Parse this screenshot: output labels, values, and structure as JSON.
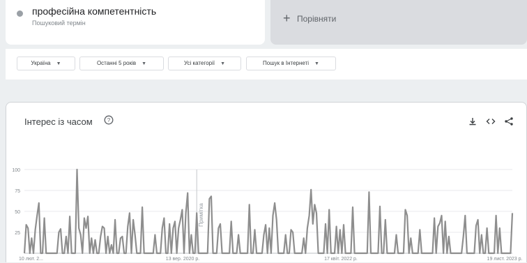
{
  "search_term": {
    "title": "професійна компетентність",
    "subtitle": "Пошуковий термін"
  },
  "compare": {
    "label": "Порівняти"
  },
  "filters": {
    "region": "Україна",
    "period": "Останні 5 років",
    "category": "Усі категорії",
    "search_type": "Пошук в Інтернеті"
  },
  "chart_header": {
    "title": "Інтерес із часом",
    "help_icon": "help-circle-icon",
    "actions": [
      "download-icon",
      "embed-code-icon",
      "share-icon"
    ]
  },
  "chart_data": {
    "type": "line",
    "title": "Інтерес із часом",
    "xlabel": "",
    "ylabel": "",
    "ylim": [
      0,
      100
    ],
    "y_ticks": [
      25,
      50,
      75,
      100
    ],
    "x_tick_labels": [
      "10 лют. 2...",
      "13 вер. 2020 р.",
      "17 квіт. 2022 р.",
      "19 лист. 2023 р."
    ],
    "annotation": "Примітка",
    "annotation_index": 95,
    "line_color": "#8e8e8e",
    "grid": true,
    "series": [
      {
        "values": [
          0,
          34,
          30,
          0,
          18,
          0,
          28,
          45,
          60,
          0,
          0,
          42,
          0,
          0,
          0,
          0,
          0,
          0,
          0,
          25,
          29,
          0,
          0,
          20,
          0,
          44,
          0,
          0,
          0,
          100,
          30,
          22,
          0,
          42,
          30,
          44,
          0,
          18,
          0,
          16,
          0,
          0,
          20,
          32,
          30,
          0,
          20,
          0,
          10,
          0,
          40,
          0,
          0,
          18,
          20,
          0,
          0,
          32,
          48,
          0,
          40,
          22,
          0,
          0,
          0,
          55,
          0,
          0,
          0,
          0,
          0,
          0,
          22,
          0,
          0,
          0,
          30,
          42,
          0,
          0,
          35,
          0,
          30,
          38,
          0,
          30,
          40,
          52,
          0,
          48,
          72,
          0,
          22,
          0,
          0,
          48,
          0,
          0,
          0,
          0,
          0,
          0,
          65,
          68,
          0,
          0,
          0,
          30,
          35,
          0,
          0,
          0,
          0,
          0,
          38,
          0,
          0,
          0,
          22,
          0,
          0,
          0,
          0,
          0,
          58,
          0,
          0,
          28,
          0,
          0,
          0,
          0,
          22,
          34,
          0,
          30,
          0,
          45,
          60,
          40,
          0,
          0,
          0,
          0,
          22,
          0,
          0,
          28,
          25,
          0,
          0,
          0,
          0,
          0,
          18,
          0,
          30,
          45,
          76,
          35,
          58,
          48,
          0,
          0,
          0,
          0,
          35,
          0,
          52,
          0,
          0,
          0,
          32,
          0,
          28,
          0,
          34,
          0,
          0,
          0,
          0,
          55,
          0,
          0,
          0,
          0,
          0,
          0,
          0,
          0,
          73,
          0,
          0,
          0,
          0,
          0,
          56,
          0,
          0,
          40,
          0,
          0,
          0,
          0,
          0,
          22,
          0,
          0,
          0,
          0,
          52,
          45,
          0,
          18,
          0,
          0,
          0,
          0,
          28,
          0,
          0,
          0,
          0,
          0,
          0,
          0,
          42,
          0,
          32,
          36,
          45,
          0,
          38,
          0,
          20,
          0,
          0,
          0,
          0,
          0,
          0,
          0,
          20,
          45,
          0,
          0,
          0,
          0,
          0,
          33,
          40,
          0,
          22,
          0,
          0,
          30,
          0,
          0,
          0,
          0,
          45,
          0,
          30,
          0,
          0,
          0,
          0,
          0,
          0,
          48
        ]
      }
    ]
  }
}
